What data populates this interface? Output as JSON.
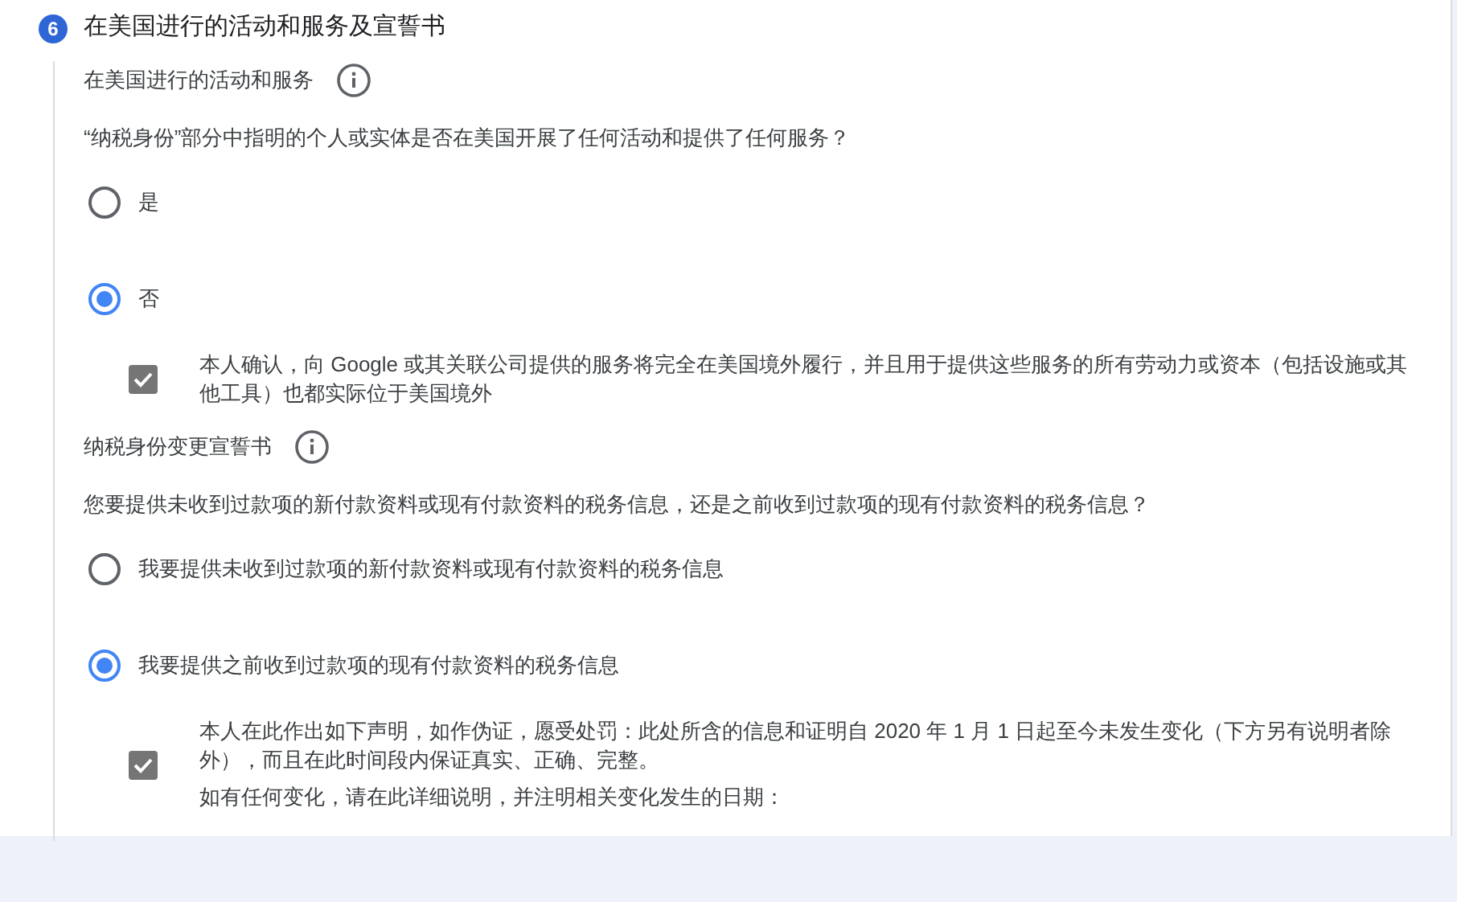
{
  "step": {
    "number": "6",
    "title": "在美国进行的活动和服务及宣誓书"
  },
  "sections": [
    {
      "title": "在美国进行的活动和服务",
      "question": "“纳税身份”部分中指明的个人或实体是否在美国开展了任何活动和提供了任何服务？",
      "options": [
        {
          "label": "是",
          "selected": false
        },
        {
          "label": "否",
          "selected": true,
          "confirmation": {
            "checked": true,
            "paragraphs": [
              "本人确认，向 Google 或其关联公司提供的服务将完全在美国境外履行，并且用于提供这些服务的所有劳动力或资本（包括设施或其他工具）也都实际位于美国境外"
            ]
          }
        }
      ]
    },
    {
      "title": "纳税身份变更宣誓书",
      "question": "您要提供未收到过款项的新付款资料或现有付款资料的税务信息，还是之前收到过款项的现有付款资料的税务信息？",
      "options": [
        {
          "label": "我要提供未收到过款项的新付款资料或现有付款资料的税务信息",
          "selected": false
        },
        {
          "label": "我要提供之前收到过款项的现有付款资料的税务信息",
          "selected": true,
          "confirmation": {
            "checked": true,
            "paragraphs": [
              "本人在此作出如下声明，如作伪证，愿受处罚：此处所含的信息和证明自 2020 年 1 月 1 日起至今未发生变化（下方另有说明者除外），而且在此时间段内保证真实、正确、完整。",
              "如有任何变化，请在此详细说明，并注明相关变化发生的日期："
            ]
          }
        }
      ]
    }
  ]
}
